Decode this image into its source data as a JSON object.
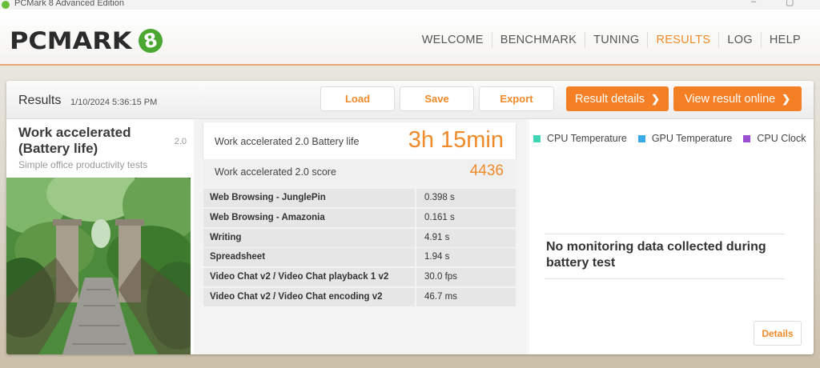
{
  "window": {
    "title": "PCMark 8 Advanced Edition",
    "minimize_glyph": "–",
    "restore_glyph": "▢"
  },
  "header": {
    "logo_text": "PCMARK",
    "logo_badge": "8",
    "nav": [
      {
        "label": "WELCOME",
        "active": false
      },
      {
        "label": "BENCHMARK",
        "active": false
      },
      {
        "label": "TUNING",
        "active": false
      },
      {
        "label": "RESULTS",
        "active": true
      },
      {
        "label": "LOG",
        "active": false
      },
      {
        "label": "HELP",
        "active": false
      }
    ]
  },
  "results": {
    "title": "Results",
    "date": "1/10/2024 5:36:15 PM",
    "buttons": {
      "load": "Load",
      "save": "Save",
      "export": "Export"
    },
    "result_details": "Result details",
    "view_online": "View result online",
    "chevron": "❯"
  },
  "test": {
    "name": "Work accelerated (Battery life)",
    "version": "2.0",
    "description": "Simple office productivity tests"
  },
  "summary": {
    "headline_label": "Work accelerated 2.0 Battery life",
    "headline_value": "3h 15min",
    "score_label": "Work accelerated 2.0 score",
    "score_value": "4436"
  },
  "subtests": [
    {
      "name": "Web Browsing - JunglePin",
      "value": "0.398 s"
    },
    {
      "name": "Web Browsing - Amazonia",
      "value": "0.161 s"
    },
    {
      "name": "Writing",
      "value": "4.91 s"
    },
    {
      "name": "Spreadsheet",
      "value": "1.94 s"
    },
    {
      "name": "Video Chat v2 / Video Chat playback 1 v2",
      "value": "30.0 fps"
    },
    {
      "name": "Video Chat v2 / Video Chat encoding v2",
      "value": "46.7 ms"
    }
  ],
  "monitoring": {
    "legend": [
      {
        "label": "CPU Temperature",
        "color": "#3fd4b4"
      },
      {
        "label": "GPU Temperature",
        "color": "#3aa9e8"
      },
      {
        "label": "CPU Clock",
        "color": "#9a4fd0"
      }
    ],
    "message": "No monitoring data collected during battery test",
    "details_label": "Details"
  },
  "colors": {
    "accent": "#f08a2a",
    "button_orange": "#f47f24"
  }
}
